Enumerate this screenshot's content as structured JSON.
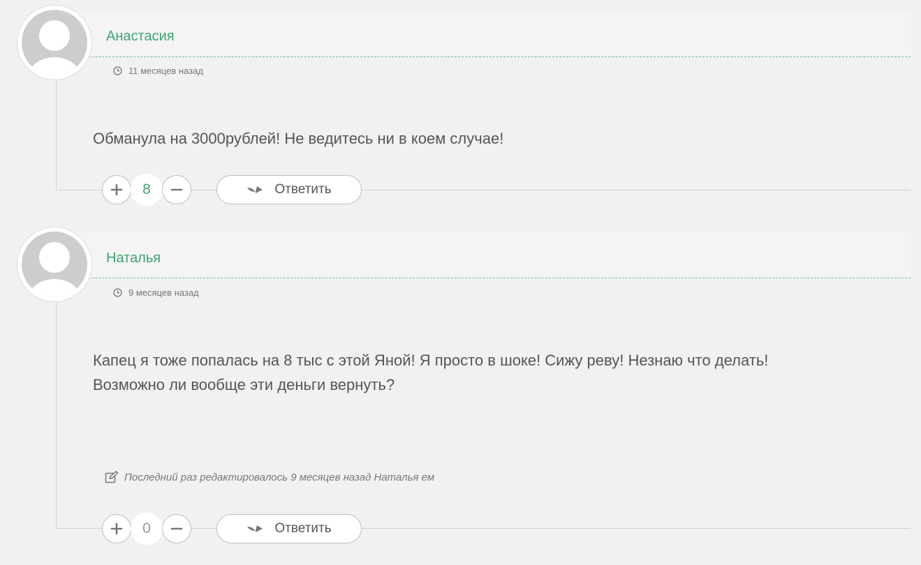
{
  "comments": [
    {
      "author": "Анастасия",
      "date": "11 месяцев назад",
      "text": [
        "Обманула на 3000рублей! Не ведитесь ни в коем случае!"
      ],
      "votes": "8",
      "reply_label": "Ответить"
    },
    {
      "author": "Наталья",
      "date": "9 месяцев назад",
      "text": [
        "Капец я тоже попалась на 8 тыс с этой Яной! Я просто в шоке! Сижу реву! Незнаю что делать!",
        "Возможно ли вообще эти деньги вернуть?"
      ],
      "edited_note": "Последний раз редактировалось 9 месяцев назад Наталья ем",
      "votes": "0",
      "reply_label": "Ответить"
    }
  ],
  "icons": {
    "avatar": "default-user-avatar",
    "date": "clock-icon",
    "edited": "edit-icon",
    "upvote": "plus-icon",
    "downvote": "minus-icon",
    "reply": "reply-arrow-icon"
  },
  "colors": {
    "accent": "#3aa66e",
    "background": "#f1f1f1",
    "text": "#555555"
  }
}
